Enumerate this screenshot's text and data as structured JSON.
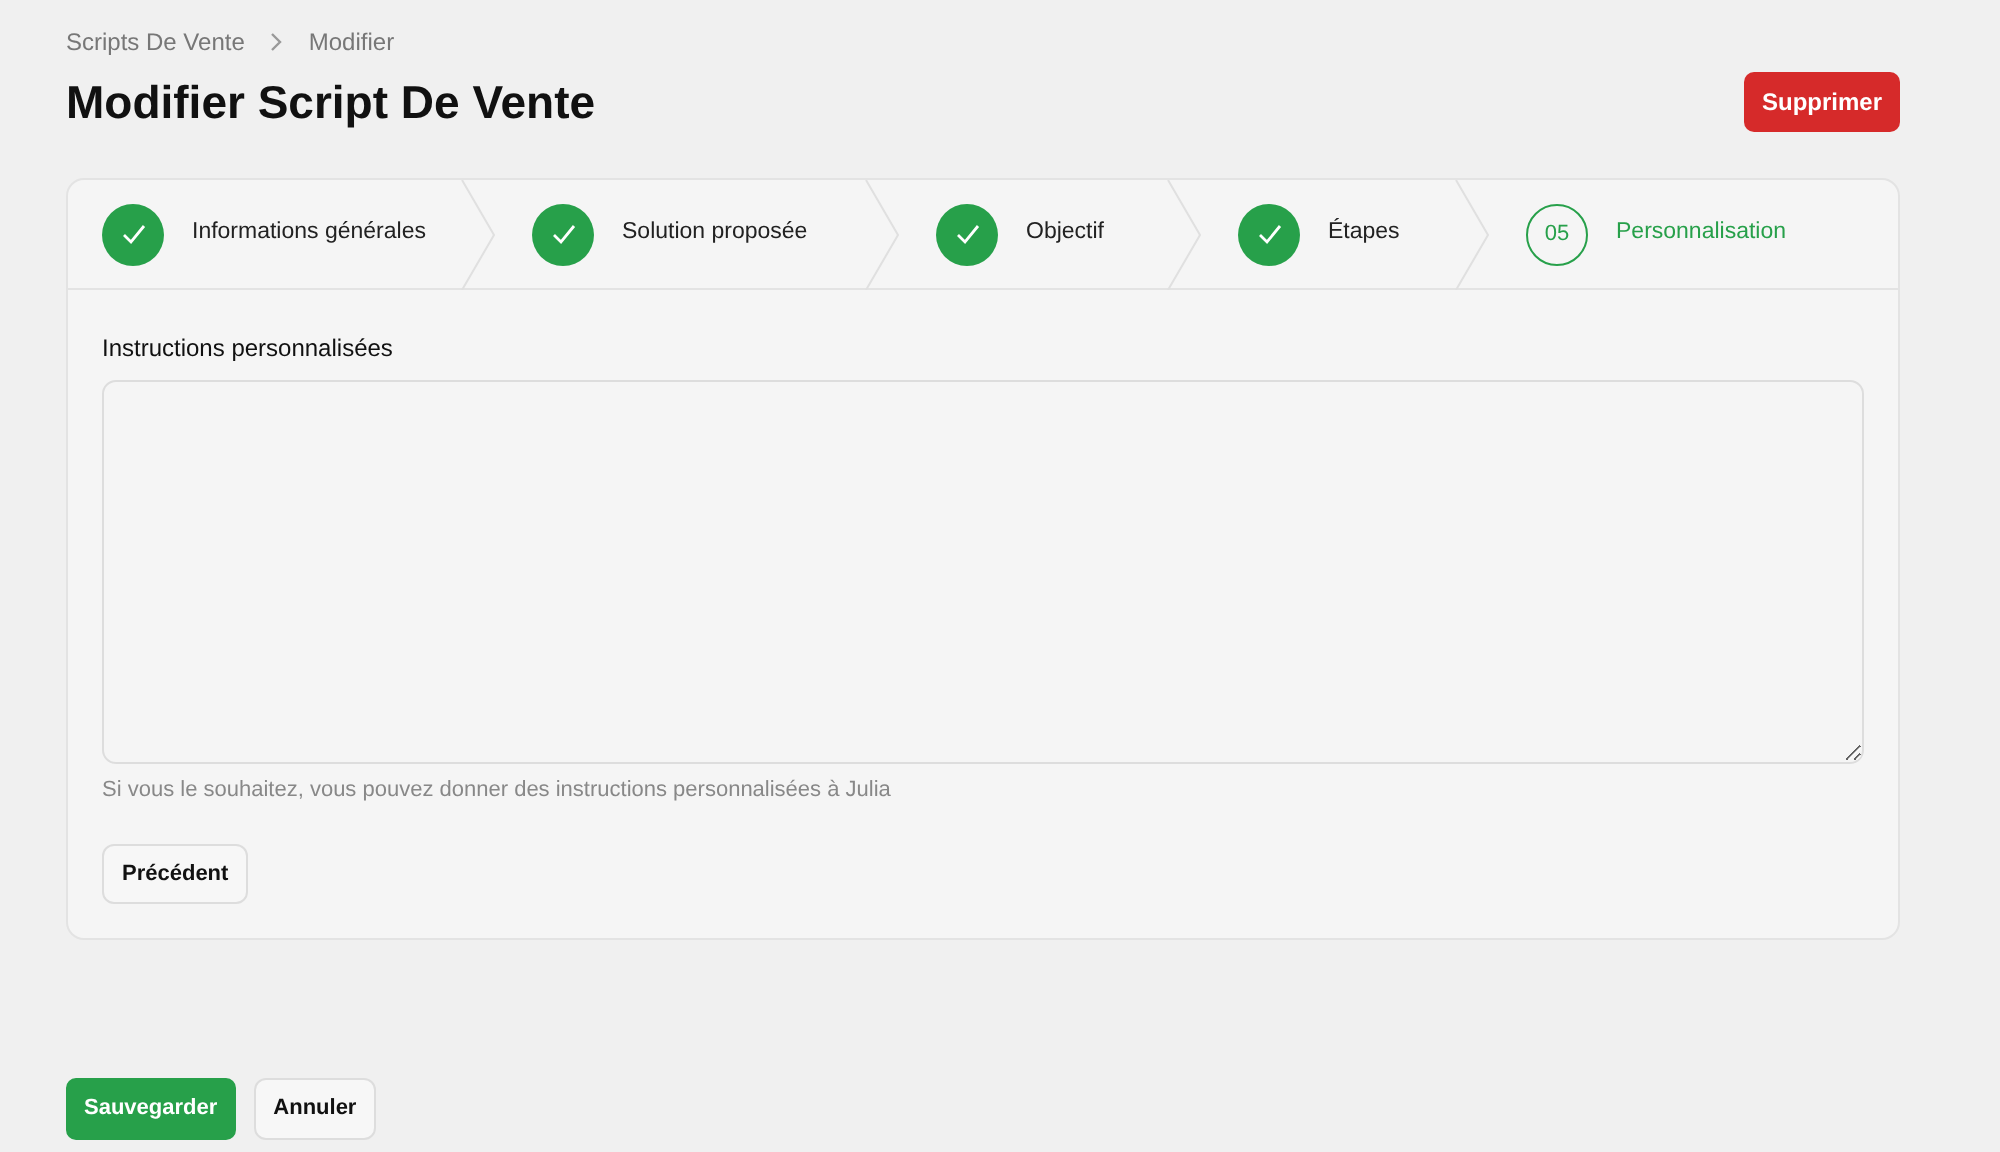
{
  "breadcrumb": [
    "Scripts De Vente",
    "Modifier"
  ],
  "title": "Modifier Script De Vente",
  "header_button": "Supprimer",
  "steps": [
    {
      "label": "Informations générales",
      "completed": true
    },
    {
      "label": "Solution proposée",
      "completed": true
    },
    {
      "label": "Objectif",
      "completed": true
    },
    {
      "label": "Étapes",
      "completed": true
    },
    {
      "label": "Personnalisation",
      "completed": false,
      "number": "05"
    }
  ],
  "field": {
    "label": "Instructions personnalisées",
    "help": "Si vous le souhaitez, vous pouvez donner des instructions personnalisées à Julia"
  },
  "card_button": "Précédent",
  "footer_buttons": [
    {
      "label": "Sauvegarder",
      "kind": "primary"
    },
    {
      "label": "Annuler",
      "kind": "secondary"
    }
  ]
}
